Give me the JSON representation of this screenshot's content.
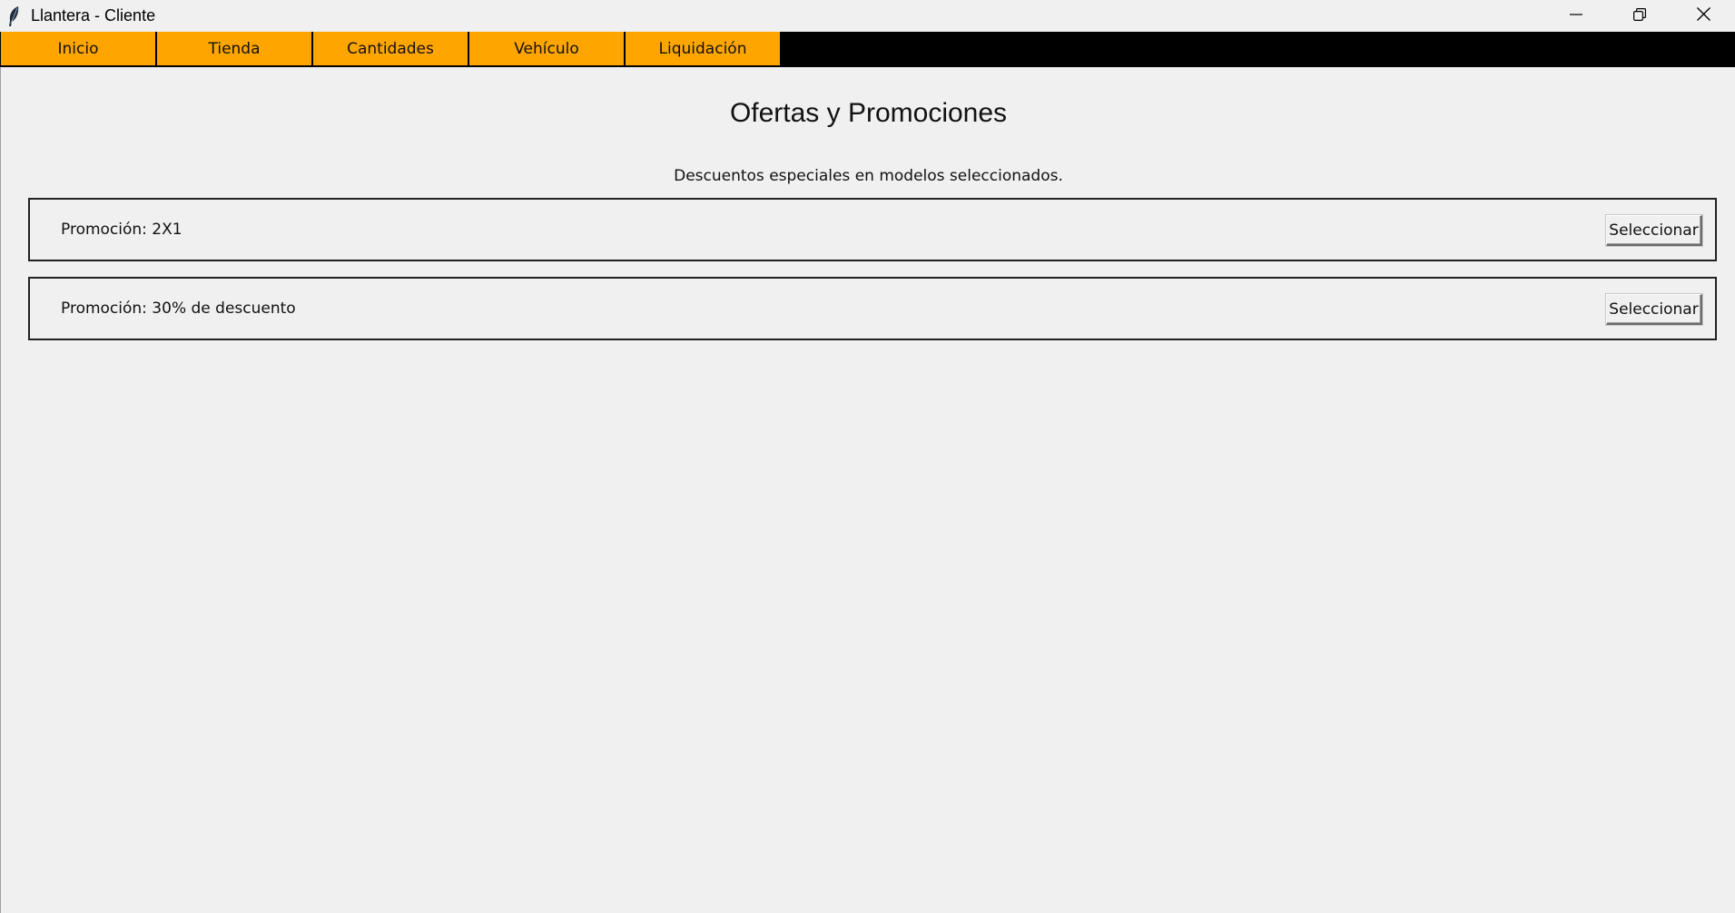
{
  "window": {
    "title": "Llantera - Cliente",
    "icon": "feather-icon",
    "controls": [
      "minimize-icon",
      "restore-icon",
      "close-icon"
    ]
  },
  "menu": {
    "items": [
      {
        "label": "Inicio"
      },
      {
        "label": "Tienda"
      },
      {
        "label": "Cantidades"
      },
      {
        "label": "Vehículo"
      },
      {
        "label": "Liquidación"
      }
    ],
    "colors": {
      "item_bg": "#ffa500",
      "bar_bg": "#000000"
    }
  },
  "main": {
    "title": "Ofertas y Promociones",
    "subtitle": "Descuentos especiales en modelos seleccionados.",
    "promotions": [
      {
        "label": "Promoción: 2X1",
        "button": "Seleccionar"
      },
      {
        "label": "Promoción: 30% de descuento",
        "button": "Seleccionar"
      }
    ]
  }
}
